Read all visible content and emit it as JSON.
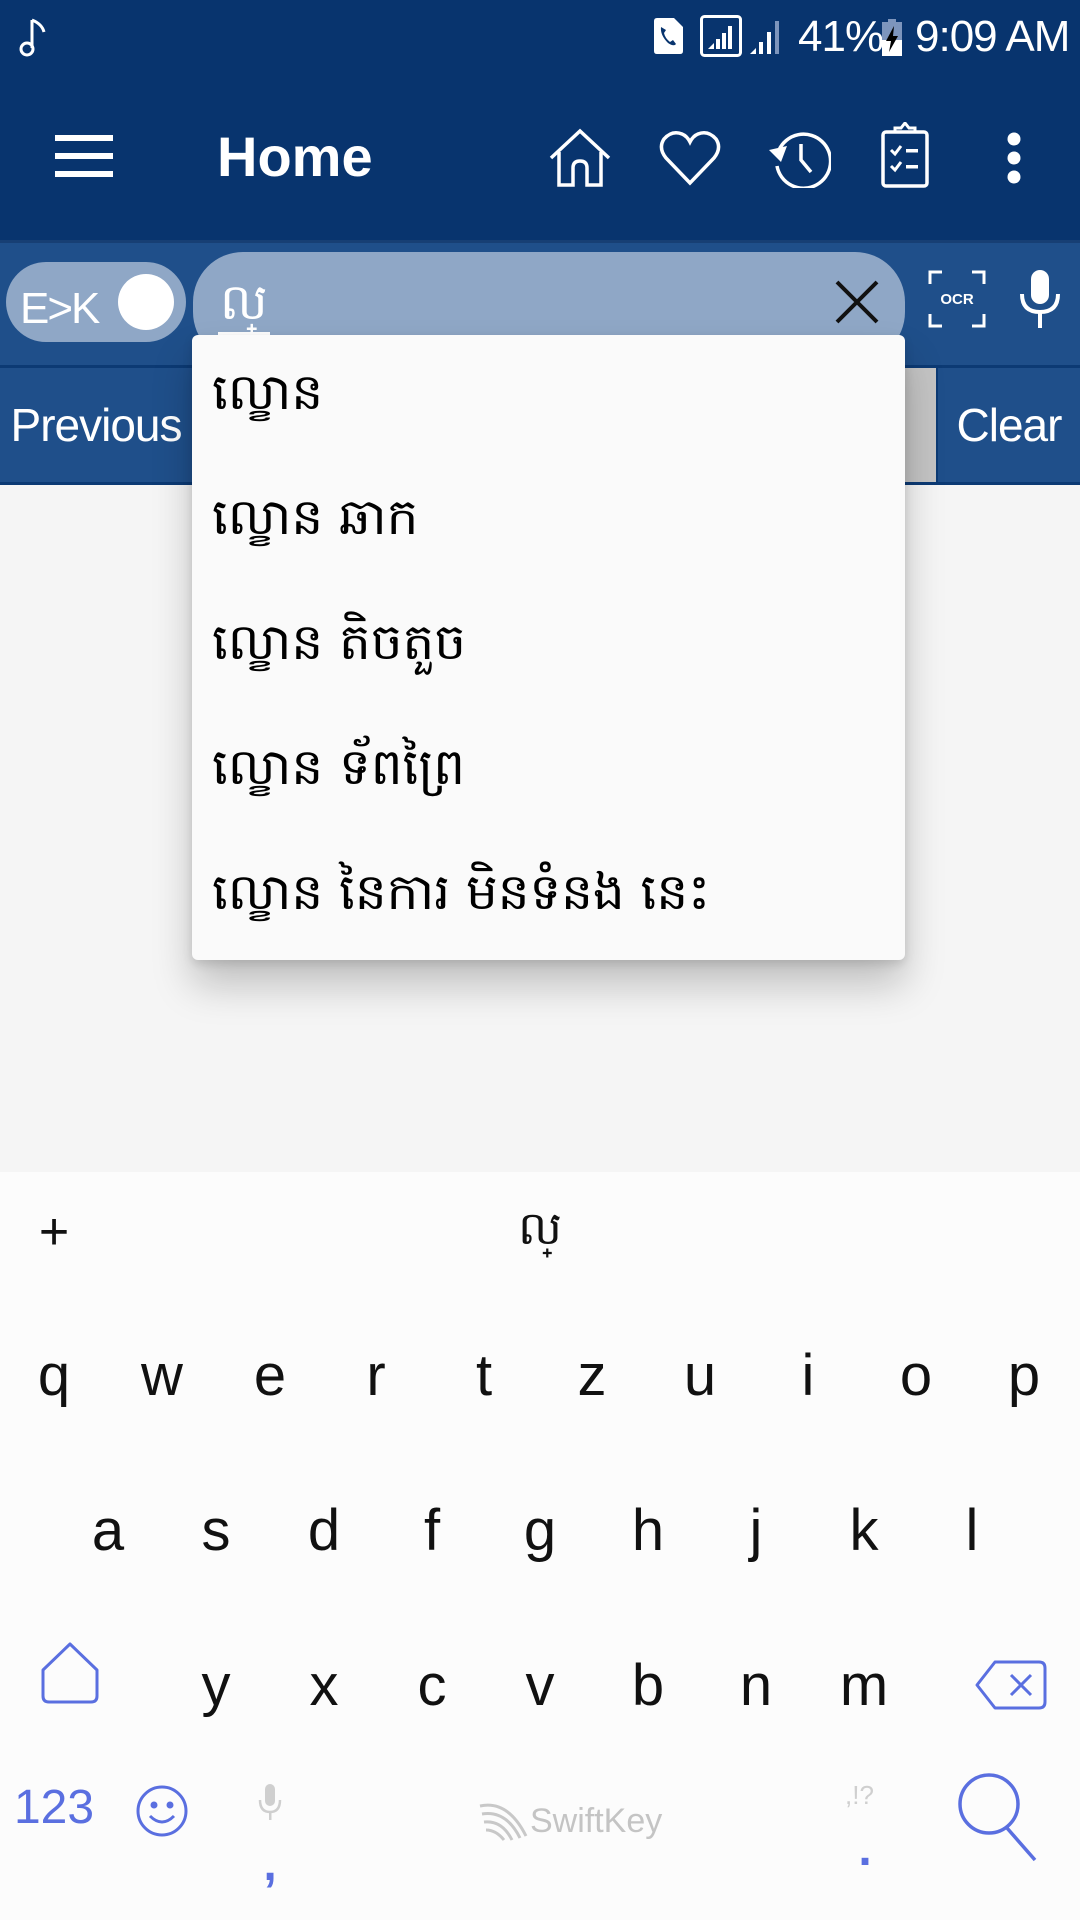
{
  "status_bar": {
    "left_icon": "music-note-icon",
    "icons": [
      "call-sim-icon",
      "signal-box-icon",
      "signal-icon"
    ],
    "battery_percent": "41%",
    "battery_icon": "battery-charging-icon",
    "time": "9:09 AM"
  },
  "app_bar": {
    "menu_icon": "hamburger-icon",
    "title": "Home",
    "actions": [
      "home-icon",
      "heart-icon",
      "history-icon",
      "clipboard-checklist-icon",
      "more-vert-icon"
    ]
  },
  "search": {
    "toggle_label": "E>K",
    "value": "ល្",
    "clear_icon": "close-icon",
    "ocr_label": "OCR",
    "mic_icon": "mic-icon"
  },
  "buttons": {
    "previous": "Previous",
    "clear": "Clear"
  },
  "suggestions": [
    "ល្ខោន",
    "ល្ខោន ឆាក",
    "ល្ខោន តិចតួច",
    "ល្ខោន ទ័ពព្រៃ",
    "ល្ខោន នៃការ មិនទំនង នេះ"
  ],
  "keyboard": {
    "toolbar": {
      "plus": "+",
      "prediction": "ល្"
    },
    "row1": [
      "q",
      "w",
      "e",
      "r",
      "t",
      "z",
      "u",
      "i",
      "o",
      "p"
    ],
    "row2": [
      "a",
      "s",
      "d",
      "f",
      "g",
      "h",
      "j",
      "k",
      "l"
    ],
    "row3": [
      "y",
      "x",
      "c",
      "v",
      "b",
      "n",
      "m"
    ],
    "numbers_label": "123",
    "comma": ",",
    "period": ".",
    "punct_hint": ",!?",
    "brand": "SwiftKey",
    "accent_color": "#5a6fe0"
  }
}
